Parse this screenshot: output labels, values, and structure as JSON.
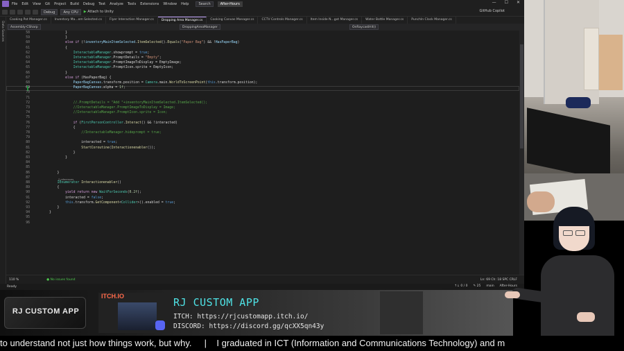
{
  "menu": {
    "items": [
      "File",
      "Edit",
      "View",
      "Git",
      "Project",
      "Build",
      "Debug",
      "Test",
      "Analyze",
      "Tools",
      "Extensions",
      "Window",
      "Help"
    ],
    "search": "Search",
    "title": "After-Hours",
    "win": [
      "—",
      "☐",
      "✕"
    ]
  },
  "toolbar": {
    "config": "Debug",
    "platform": "Any CPU",
    "run": "Attach to Unity",
    "copilot": "GitHub Copilot"
  },
  "side_strip": "Data Sources",
  "tabs": [
    "Cooking Pot Manager.cs",
    "Inventory Ma...em Selected.cs",
    "Flyer Interaction Manager.cs",
    "Dropping Area Manager.cs",
    "Cooking Canvas Manager.cs",
    "CCTV Controls Manager.cs",
    "Item Inside N...got Manager.cs",
    "Water Bottle Manager.cs",
    "PunchIn Clock Manager.cs"
  ],
  "nav": {
    "project": "Assembly-CSharp",
    "class": "DroppingAreaManager",
    "member": "OnRaycastHit()"
  },
  "code_lines": [
    {
      "n": "58",
      "t": [
        [
          "        }",
          ""
        ]
      ]
    },
    {
      "n": "59",
      "t": [
        [
          "        }",
          ""
        ]
      ]
    },
    {
      "n": "60",
      "t": [
        [
          "        ",
          ""
        ],
        [
          "else if",
          "ctl"
        ],
        [
          " (!",
          ""
        ],
        [
          "inventoryMainItemSelected",
          "id"
        ],
        [
          ".",
          ""
        ],
        [
          "ItemSelected",
          "fn"
        ],
        [
          "().",
          ""
        ],
        [
          "Equals",
          "fn"
        ],
        [
          "(",
          ""
        ],
        [
          "\"Paper Bag\"",
          "str"
        ],
        [
          ") && !",
          ""
        ],
        [
          "HasPaperBag",
          "id"
        ],
        [
          ")",
          ""
        ]
      ]
    },
    {
      "n": "61",
      "t": [
        [
          "        {",
          ""
        ]
      ]
    },
    {
      "n": "62",
      "t": [
        [
          "            ",
          ""
        ],
        [
          "InteractableManager",
          "ty"
        ],
        [
          ".showprompt = ",
          ""
        ],
        [
          "true",
          "kw"
        ],
        [
          ";",
          ""
        ]
      ]
    },
    {
      "n": "63",
      "t": [
        [
          "            ",
          ""
        ],
        [
          "InteractableManager",
          "ty"
        ],
        [
          ".PromptDetails = ",
          ""
        ],
        [
          "\"Empty\"",
          "str"
        ],
        [
          ";",
          ""
        ]
      ]
    },
    {
      "n": "64",
      "t": [
        [
          "            ",
          ""
        ],
        [
          "InteractableManager",
          "ty"
        ],
        [
          ".PromptImageToDisplay = EmptyImage;",
          ""
        ]
      ]
    },
    {
      "n": "65",
      "t": [
        [
          "            ",
          ""
        ],
        [
          "InteractableManager",
          "ty"
        ],
        [
          ".PromptIcon.sprite = EmptyIcon;",
          ""
        ]
      ]
    },
    {
      "n": "66",
      "t": [
        [
          "        }",
          ""
        ]
      ]
    },
    {
      "n": "67",
      "t": [
        [
          "        ",
          ""
        ],
        [
          "else if",
          "ctl"
        ],
        [
          " (HasPaperBag) {",
          ""
        ]
      ]
    },
    {
      "n": "68",
      "t": [
        [
          "            ",
          ""
        ],
        [
          "PaperBagCanvas",
          "id"
        ],
        [
          ".transform.position = ",
          ""
        ],
        [
          "Camera",
          "ty"
        ],
        [
          ".main.",
          ""
        ],
        [
          "WorldToScreenPoint",
          "fn"
        ],
        [
          "(",
          ""
        ],
        [
          "this",
          "kw"
        ],
        [
          ".transform.position);",
          ""
        ]
      ]
    },
    {
      "n": "69",
      "t": [
        [
          "            ",
          ""
        ],
        [
          "PaperBagCanvas",
          "id"
        ],
        [
          ".alpha = ",
          ""
        ],
        [
          "1f",
          "num"
        ],
        [
          ";",
          ""
        ]
      ]
    },
    {
      "n": "70",
      "t": [
        [
          "",
          ""
        ]
      ]
    },
    {
      "n": "71",
      "t": [
        [
          "",
          ""
        ]
      ]
    },
    {
      "n": "72",
      "t": [
        [
          "            ",
          ""
        ],
        [
          "//.PromptDetails = \"Add \"+inventoryMainItemSelected.ItemSelected();",
          "cm"
        ]
      ]
    },
    {
      "n": "73",
      "t": [
        [
          "            ",
          ""
        ],
        [
          "//InteractableManager.PromptImageToDisplay = Image;",
          "cm"
        ]
      ]
    },
    {
      "n": "74",
      "t": [
        [
          "            ",
          ""
        ],
        [
          "//InteractableManager.PromptIcon.sprite = Icon;",
          "cm"
        ]
      ]
    },
    {
      "n": "75",
      "t": [
        [
          "",
          ""
        ]
      ]
    },
    {
      "n": "76",
      "t": [
        [
          "            ",
          ""
        ],
        [
          "if",
          "ctl"
        ],
        [
          " (",
          ""
        ],
        [
          "FirstPersonController",
          "ty"
        ],
        [
          ".",
          ""
        ],
        [
          "Interact",
          "fn"
        ],
        [
          "() && !interacted)",
          ""
        ]
      ]
    },
    {
      "n": "77",
      "t": [
        [
          "            {",
          ""
        ]
      ]
    },
    {
      "n": "78",
      "t": [
        [
          "                ",
          ""
        ],
        [
          "//InteractableManager.hideprompt = true;",
          "cm"
        ]
      ]
    },
    {
      "n": "79",
      "t": [
        [
          "",
          ""
        ]
      ]
    },
    {
      "n": "80",
      "t": [
        [
          "                interacted = ",
          ""
        ],
        [
          "true",
          "kw"
        ],
        [
          ";",
          ""
        ]
      ]
    },
    {
      "n": "81",
      "t": [
        [
          "                ",
          ""
        ],
        [
          "StartCoroutine",
          "fn"
        ],
        [
          "(",
          ""
        ],
        [
          "Interactionenabler",
          "fn"
        ],
        [
          "());",
          ""
        ]
      ]
    },
    {
      "n": "82",
      "t": [
        [
          "            }",
          ""
        ]
      ]
    },
    {
      "n": "83",
      "t": [
        [
          "        }",
          ""
        ]
      ]
    },
    {
      "n": "84",
      "t": [
        [
          "",
          ""
        ]
      ]
    },
    {
      "n": "85",
      "t": [
        [
          "",
          ""
        ]
      ]
    },
    {
      "n": "86",
      "t": [
        [
          "    }",
          ""
        ]
      ]
    },
    {
      "n": "87",
      "t": [
        [
          "",
          ""
        ]
      ]
    },
    {
      "n": "88",
      "t": [
        [
          "    ",
          ""
        ],
        [
          "IEnumerator",
          "ty"
        ],
        [
          " ",
          ""
        ],
        [
          "Interactionenabler",
          "fn"
        ],
        [
          "()",
          ""
        ]
      ]
    },
    {
      "n": "89",
      "t": [
        [
          "    {",
          ""
        ]
      ]
    },
    {
      "n": "90",
      "t": [
        [
          "        ",
          ""
        ],
        [
          "yield return new",
          "ctl"
        ],
        [
          " ",
          ""
        ],
        [
          "WaitForSeconds",
          "ty"
        ],
        [
          "(",
          ""
        ],
        [
          "0.2f",
          "num"
        ],
        [
          ");",
          ""
        ]
      ]
    },
    {
      "n": "91",
      "t": [
        [
          "        interacted = ",
          ""
        ],
        [
          "false",
          "kw"
        ],
        [
          ";",
          ""
        ]
      ]
    },
    {
      "n": "92",
      "t": [
        [
          "        ",
          ""
        ],
        [
          "this",
          "kw"
        ],
        [
          ".transform.",
          ""
        ],
        [
          "GetComponent",
          "fn"
        ],
        [
          "<",
          ""
        ],
        [
          "Collider",
          "ty"
        ],
        [
          ">().enabled = ",
          ""
        ],
        [
          "true",
          "kw"
        ],
        [
          ";",
          ""
        ]
      ]
    },
    {
      "n": "93",
      "t": [
        [
          "    }",
          ""
        ]
      ]
    },
    {
      "n": "94",
      "t": [
        [
          "}",
          ""
        ]
      ]
    },
    {
      "n": "95",
      "t": [
        [
          "",
          ""
        ]
      ]
    },
    {
      "n": "96",
      "t": [
        [
          "",
          ""
        ]
      ]
    }
  ],
  "active_line": "69",
  "references_hint": "2 references",
  "editor_status": {
    "zoom": "110 %",
    "issues": "No issues found",
    "pos": "Ln: 69    Ch: 18    SPC    CRLF"
  },
  "status": {
    "ready": "Ready",
    "right": [
      "↑↓ 0 / 0",
      "✎ 25",
      "main",
      "After-Hours"
    ]
  },
  "banner": {
    "logo": "RJ CUSTOM APP",
    "itch_label": "ITCH.IO",
    "app_name": "RJ CUSTOM APP",
    "itch_line": "ITCH: https://rjcustomapp.itch.io/",
    "discord_line": "DISCORD: https://discord.gg/qcXX5qn43y"
  },
  "ticker": "to understand not just how things work, but why.     |    I graduated in ICT (Information and Communications Technology) and m"
}
